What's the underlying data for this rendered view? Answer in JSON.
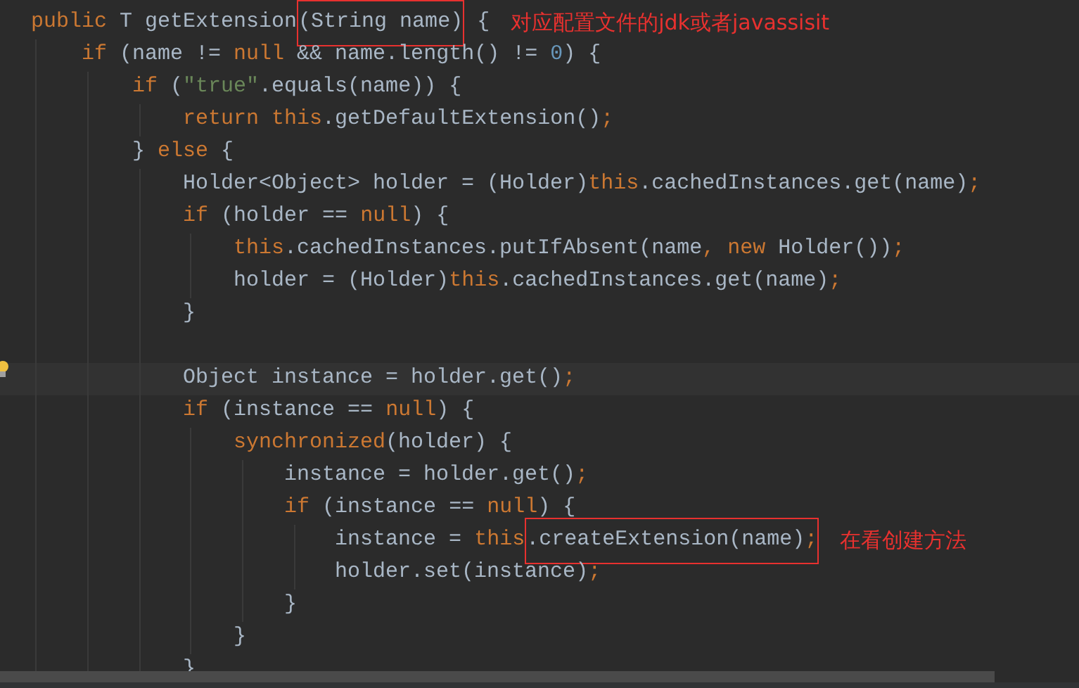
{
  "lines": [
    {
      "kind": "code",
      "current": false,
      "tokens": [
        {
          "text": "public",
          "kind": "kw"
        },
        {
          "text": " T getExtension",
          "kind": "plain"
        },
        {
          "text": "(String name)",
          "kind": "plain",
          "boxed": true
        },
        {
          "text": " {",
          "kind": "plain"
        }
      ],
      "note": "对应配置文件的jdk或者javassisit"
    },
    {
      "kind": "code",
      "current": false,
      "tokens": [
        {
          "text": "    if",
          "kind": "kw"
        },
        {
          "text": " (name != ",
          "kind": "plain"
        },
        {
          "text": "null",
          "kind": "kw"
        },
        {
          "text": " && name.length() != ",
          "kind": "plain"
        },
        {
          "text": "0",
          "kind": "num"
        },
        {
          "text": ") {",
          "kind": "plain"
        }
      ]
    },
    {
      "kind": "code",
      "current": false,
      "tokens": [
        {
          "text": "        if",
          "kind": "kw"
        },
        {
          "text": " (",
          "kind": "plain"
        },
        {
          "text": "\"true\"",
          "kind": "str"
        },
        {
          "text": ".equals(name)) {",
          "kind": "plain"
        }
      ]
    },
    {
      "kind": "code",
      "current": false,
      "tokens": [
        {
          "text": "            return this",
          "kind": "kw"
        },
        {
          "text": ".getDefaultExtension()",
          "kind": "plain"
        },
        {
          "text": ";",
          "kind": "kw"
        }
      ]
    },
    {
      "kind": "code",
      "current": false,
      "tokens": [
        {
          "text": "        } ",
          "kind": "plain"
        },
        {
          "text": "else",
          "kind": "kw"
        },
        {
          "text": " {",
          "kind": "plain"
        }
      ]
    },
    {
      "kind": "code",
      "current": false,
      "tokens": [
        {
          "text": "            Holder<Object> holder = (Holder)",
          "kind": "plain"
        },
        {
          "text": "this",
          "kind": "kw"
        },
        {
          "text": ".cachedInstances.get(name)",
          "kind": "plain"
        },
        {
          "text": ";",
          "kind": "kw"
        }
      ]
    },
    {
      "kind": "code",
      "current": false,
      "tokens": [
        {
          "text": "            if",
          "kind": "kw"
        },
        {
          "text": " (holder == ",
          "kind": "plain"
        },
        {
          "text": "null",
          "kind": "kw"
        },
        {
          "text": ") {",
          "kind": "plain"
        }
      ]
    },
    {
      "kind": "code",
      "current": false,
      "tokens": [
        {
          "text": "                this",
          "kind": "kw"
        },
        {
          "text": ".cachedInstances.putIfAbsent(name",
          "kind": "plain"
        },
        {
          "text": ", new",
          "kind": "kw"
        },
        {
          "text": " Holder())",
          "kind": "plain"
        },
        {
          "text": ";",
          "kind": "kw"
        }
      ]
    },
    {
      "kind": "code",
      "current": false,
      "tokens": [
        {
          "text": "                holder = (Holder)",
          "kind": "plain"
        },
        {
          "text": "this",
          "kind": "kw"
        },
        {
          "text": ".cachedInstances.get(name)",
          "kind": "plain"
        },
        {
          "text": ";",
          "kind": "kw"
        }
      ]
    },
    {
      "kind": "code",
      "current": false,
      "tokens": [
        {
          "text": "            }",
          "kind": "plain"
        }
      ]
    },
    {
      "kind": "blank",
      "current": false
    },
    {
      "kind": "code",
      "current": true,
      "tokens": [
        {
          "text": "            Object instance = holder.get()",
          "kind": "plain"
        },
        {
          "text": ";",
          "kind": "kw"
        }
      ]
    },
    {
      "kind": "code",
      "current": false,
      "tokens": [
        {
          "text": "            if",
          "kind": "kw"
        },
        {
          "text": " (instance == ",
          "kind": "plain"
        },
        {
          "text": "null",
          "kind": "kw"
        },
        {
          "text": ") {",
          "kind": "plain"
        }
      ]
    },
    {
      "kind": "code",
      "current": false,
      "tokens": [
        {
          "text": "                synchronized",
          "kind": "kw"
        },
        {
          "text": "(holder) {",
          "kind": "plain"
        }
      ]
    },
    {
      "kind": "code",
      "current": false,
      "tokens": [
        {
          "text": "                    instance = holder.get()",
          "kind": "plain"
        },
        {
          "text": ";",
          "kind": "kw"
        }
      ]
    },
    {
      "kind": "code",
      "current": false,
      "tokens": [
        {
          "text": "                    if",
          "kind": "kw"
        },
        {
          "text": " (instance == ",
          "kind": "plain"
        },
        {
          "text": "null",
          "kind": "kw"
        },
        {
          "text": ") {",
          "kind": "plain"
        }
      ]
    },
    {
      "kind": "code",
      "current": false,
      "tokens": [
        {
          "text": "                        instance = ",
          "kind": "plain"
        },
        {
          "text": "this",
          "kind": "kw"
        },
        {
          "text": ".createExtension(name)",
          "kind": "plain",
          "boxed": true
        },
        {
          "text": ";",
          "kind": "kw",
          "boxed": true
        }
      ],
      "note": "在看创建方法"
    },
    {
      "kind": "code",
      "current": false,
      "tokens": [
        {
          "text": "                        holder.set(instance)",
          "kind": "plain"
        },
        {
          "text": ";",
          "kind": "kw"
        }
      ]
    },
    {
      "kind": "code",
      "current": false,
      "tokens": [
        {
          "text": "                    }",
          "kind": "plain"
        }
      ]
    },
    {
      "kind": "code",
      "current": false,
      "tokens": [
        {
          "text": "                }",
          "kind": "plain"
        }
      ]
    },
    {
      "kind": "code",
      "current": false,
      "tokens": [
        {
          "text": "            }",
          "kind": "plain"
        }
      ]
    }
  ]
}
